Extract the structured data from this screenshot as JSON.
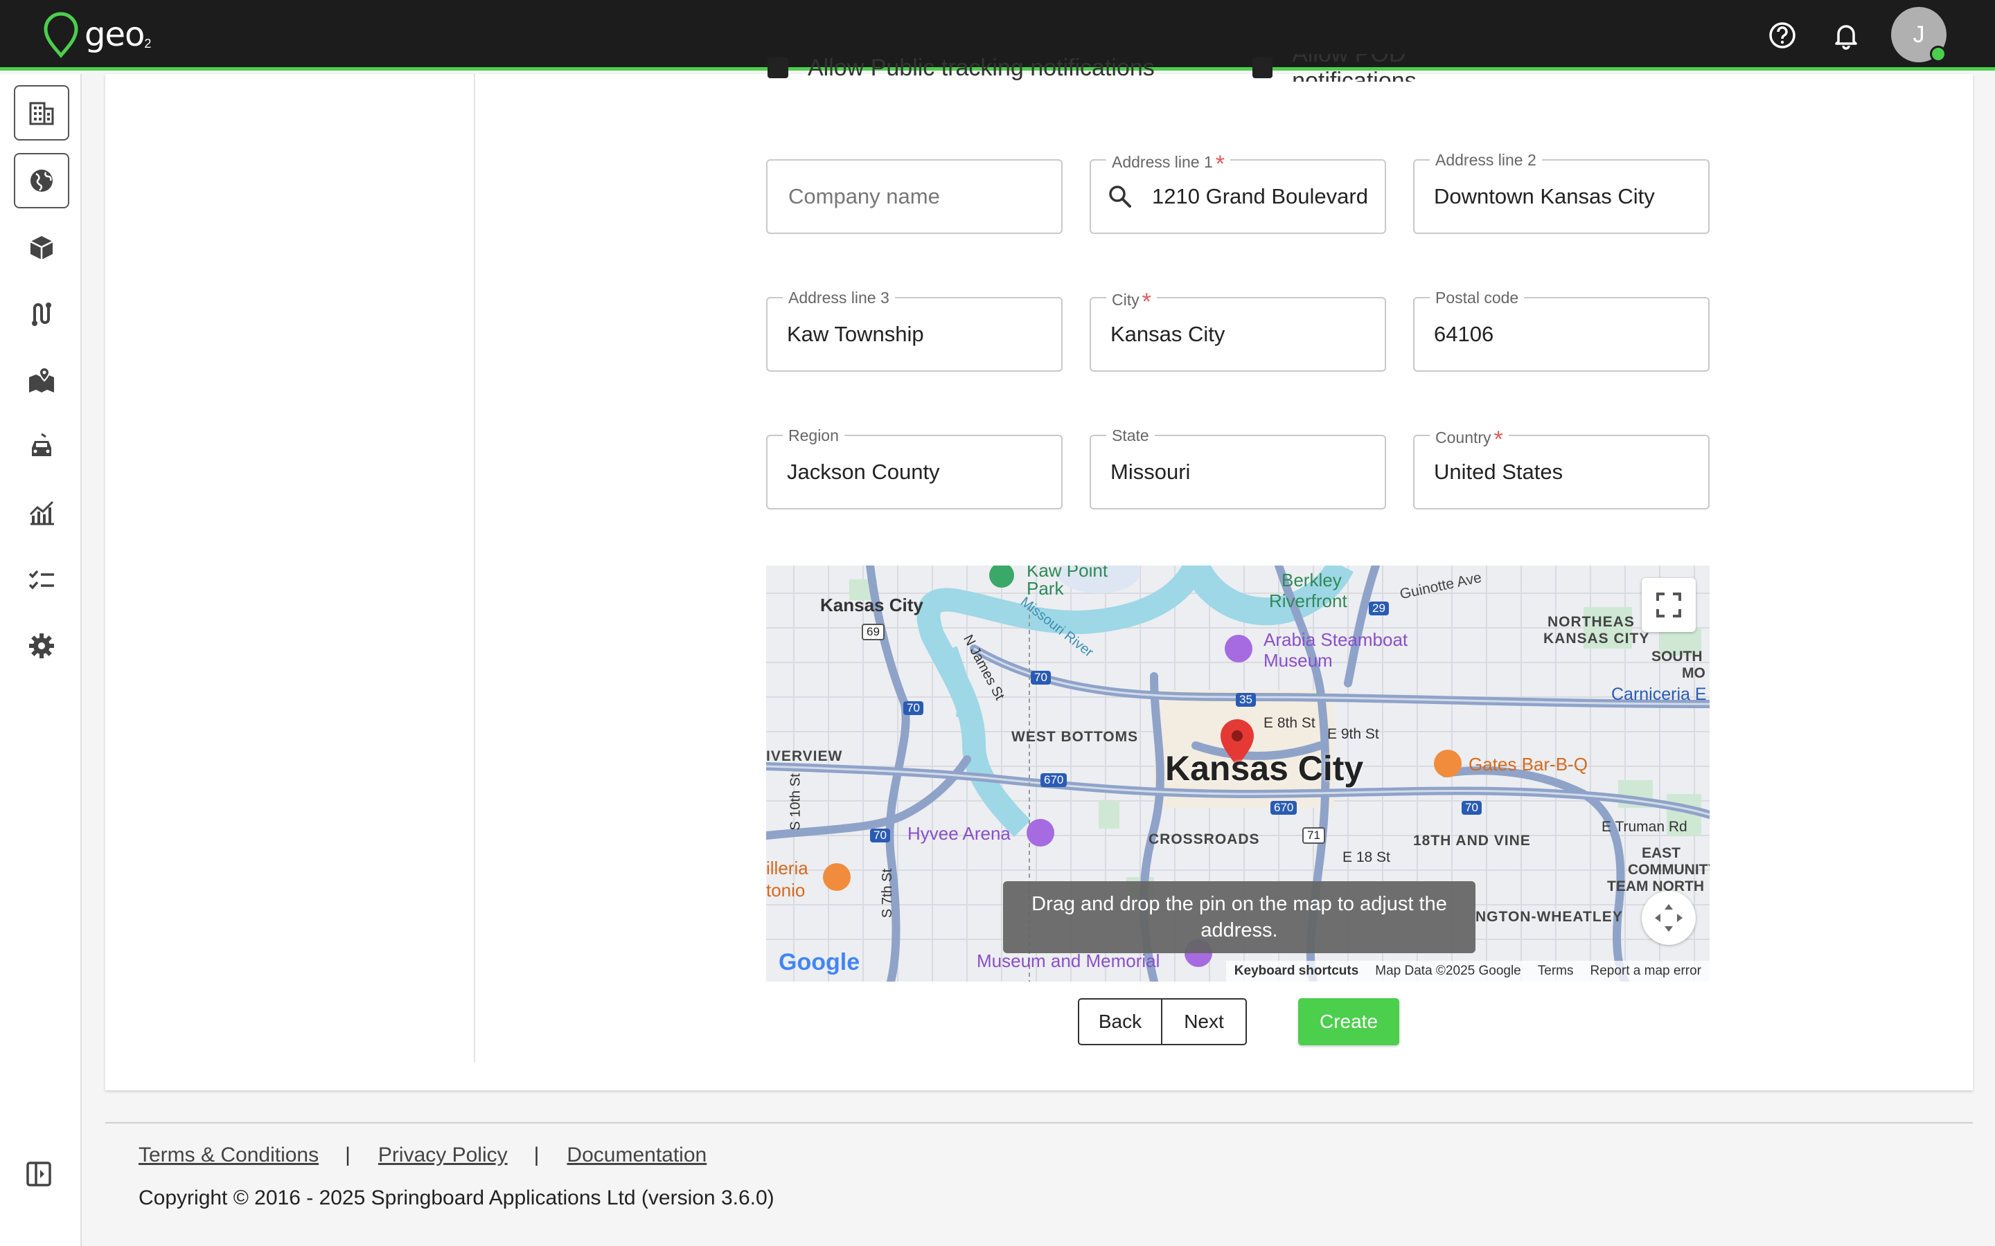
{
  "app": {
    "logo_text": "geo",
    "logo_sub": "2",
    "avatar_initial": "J",
    "accent_color": "#4ccf4c"
  },
  "header_icons": [
    "help-circle-icon",
    "bell-icon"
  ],
  "sidebar": {
    "items": [
      {
        "name": "sidebar-item-companies",
        "icon": "building-icon"
      },
      {
        "name": "sidebar-item-locations",
        "icon": "globe-icon"
      },
      {
        "name": "sidebar-item-packages",
        "icon": "package-icon"
      },
      {
        "name": "sidebar-item-routes",
        "icon": "route-icon"
      },
      {
        "name": "sidebar-item-map",
        "icon": "map-pin-icon"
      },
      {
        "name": "sidebar-item-vehicles",
        "icon": "car-icon"
      },
      {
        "name": "sidebar-item-reports",
        "icon": "chart-icon"
      },
      {
        "name": "sidebar-item-tasks",
        "icon": "checklist-icon"
      },
      {
        "name": "sidebar-item-settings",
        "icon": "gear-icon"
      }
    ],
    "collapse_icon": "sidebar-collapse-icon"
  },
  "form": {
    "checkboxes": [
      {
        "label": "Allow Public tracking notifications",
        "checked": true
      },
      {
        "label": "Allow POD notifications",
        "checked": true
      }
    ],
    "fields": {
      "company_name": {
        "placeholder": "Company name",
        "value": ""
      },
      "address1": {
        "label": "Address line 1",
        "required": "*",
        "value": "1210 Grand Boulevard"
      },
      "address2": {
        "label": "Address line 2",
        "value": "Downtown Kansas City"
      },
      "address3": {
        "label": "Address line 3",
        "value": "Kaw Township"
      },
      "city": {
        "label": "City",
        "required": "*",
        "value": "Kansas City"
      },
      "postal": {
        "label": "Postal code",
        "value": "64106"
      },
      "region": {
        "label": "Region",
        "value": "Jackson County"
      },
      "state": {
        "label": "State",
        "value": "Missouri"
      },
      "country": {
        "label": "Country",
        "required": "*",
        "value": "United States"
      }
    }
  },
  "map": {
    "tooltip": "Drag and drop the pin on the map to adjust the address.",
    "labels": {
      "kansas_city_big": "Kansas City",
      "kansas_city_nw": "Kansas City",
      "kaw_point": "Kaw Point",
      "park": "Park",
      "berkley": "Berkley",
      "riverfront": "Riverfront",
      "guinotte": "Guinotte Ave",
      "northeast1": "NORTHEAS",
      "northeast2": "KANSAS CITY",
      "south": "SOUTH",
      "mo": "MO",
      "carniceria": "Carniceria E",
      "arabia1": "Arabia Steamboat",
      "arabia2": "Museum",
      "missouri_river": "Missouri River",
      "james_st": "N James St",
      "west_bottoms": "WEST BOTTOMS",
      "riverview": "IVERVIEW",
      "e8th": "E 8th St",
      "e9th": "E 9th St",
      "gates": "Gates Bar-B-Q",
      "s10th": "S 10th St",
      "hyvee": "Hyvee Arena",
      "crossroads": "CROSSROADS",
      "e18th": "E 18 St",
      "18vine": "18TH AND VINE",
      "truman": "E Truman Rd",
      "east1": "EAST",
      "east2": "COMMUNITY",
      "east3": "TEAM NORTH",
      "wheatley": "NGTON-WHEATLEY",
      "illeria1": "illeria",
      "illeria2": "tonio",
      "s7th": "S 7th St",
      "museum_memorial": "Museum and Memorial",
      "google": "Google",
      "i69": "69",
      "i70a": "70",
      "i70b": "70",
      "i70c": "70",
      "i70d": "70",
      "i670a": "670",
      "i670b": "670",
      "i35": "35",
      "i29": "29",
      "i71": "71"
    },
    "footer": {
      "shortcuts": "Keyboard shortcuts",
      "data": "Map Data ©2025 Google",
      "terms": "Terms",
      "report": "Report a map error"
    }
  },
  "actions": {
    "back": "Back",
    "next": "Next",
    "create": "Create"
  },
  "footer": {
    "links": [
      "Terms & Conditions",
      "Privacy Policy",
      "Documentation"
    ],
    "separator": "|",
    "copyright": "Copyright © 2016 - 2025 Springboard Applications Ltd (version 3.6.0)"
  }
}
